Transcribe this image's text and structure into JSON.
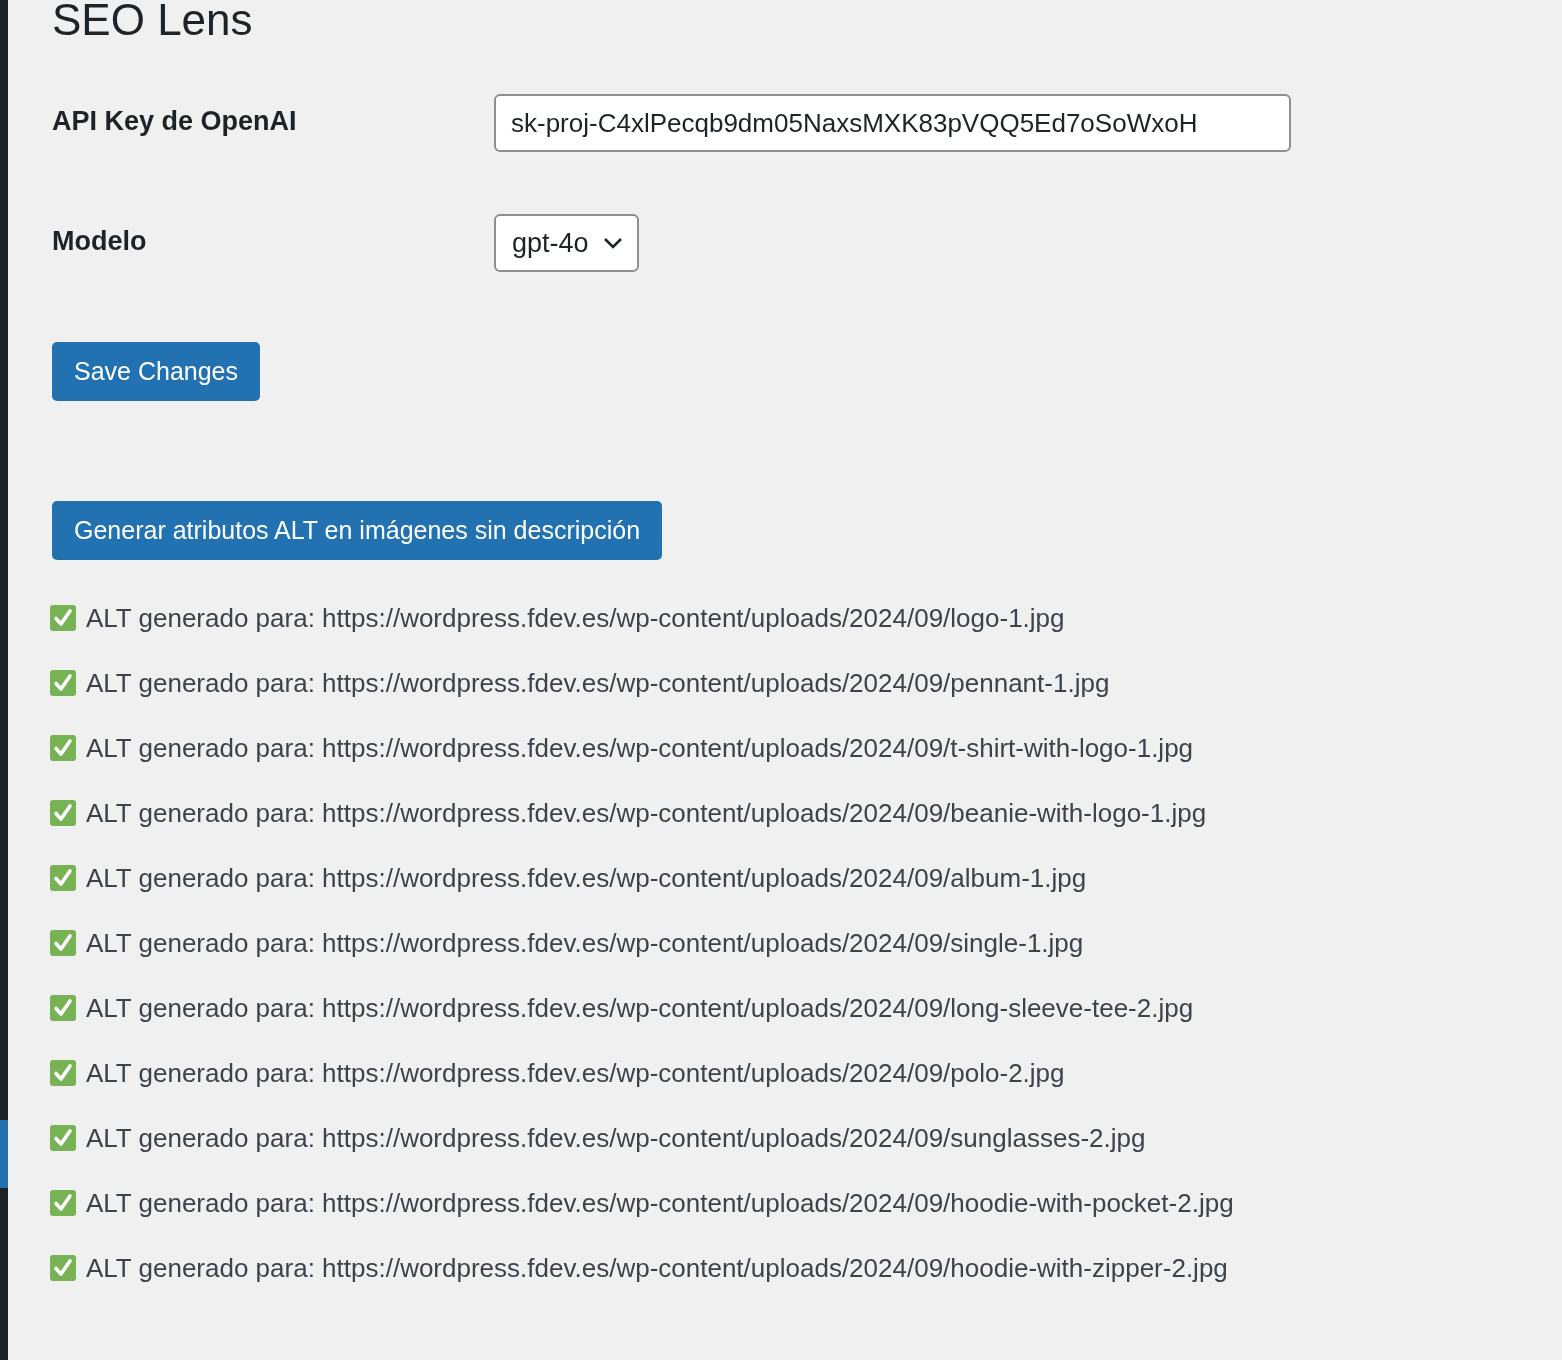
{
  "title": "SEO Lens",
  "settings": [
    {
      "kind": "text",
      "label": "API Key de OpenAI",
      "value": "sk-proj-C4xlPecqb9dm05NaxsMXK83pVQQ5Ed7oSoWxoH"
    },
    {
      "kind": "select",
      "label": "Modelo",
      "value": "gpt-4o"
    }
  ],
  "save_button": "Save Changes",
  "generate_button": "Generar atributos ALT en imágenes sin descripción",
  "log": [
    {
      "checked": true,
      "text": "ALT generado para: https://wordpress.fdev.es/wp-content/uploads/2024/09/logo-1.jpg"
    },
    {
      "checked": true,
      "text": "ALT generado para: https://wordpress.fdev.es/wp-content/uploads/2024/09/pennant-1.jpg"
    },
    {
      "checked": true,
      "text": "ALT generado para: https://wordpress.fdev.es/wp-content/uploads/2024/09/t-shirt-with-logo-1.jpg"
    },
    {
      "checked": true,
      "text": "ALT generado para: https://wordpress.fdev.es/wp-content/uploads/2024/09/beanie-with-logo-1.jpg"
    },
    {
      "checked": true,
      "text": "ALT generado para: https://wordpress.fdev.es/wp-content/uploads/2024/09/album-1.jpg"
    },
    {
      "checked": true,
      "text": "ALT generado para: https://wordpress.fdev.es/wp-content/uploads/2024/09/single-1.jpg"
    },
    {
      "checked": true,
      "text": "ALT generado para: https://wordpress.fdev.es/wp-content/uploads/2024/09/long-sleeve-tee-2.jpg"
    },
    {
      "checked": true,
      "text": "ALT generado para: https://wordpress.fdev.es/wp-content/uploads/2024/09/polo-2.jpg"
    },
    {
      "checked": true,
      "text": "ALT generado para: https://wordpress.fdev.es/wp-content/uploads/2024/09/sunglasses-2.jpg"
    },
    {
      "checked": true,
      "text": "ALT generado para: https://wordpress.fdev.es/wp-content/uploads/2024/09/hoodie-with-pocket-2.jpg"
    },
    {
      "checked": true,
      "text": "ALT generado para: https://wordpress.fdev.es/wp-content/uploads/2024/09/hoodie-with-zipper-2.jpg"
    }
  ]
}
